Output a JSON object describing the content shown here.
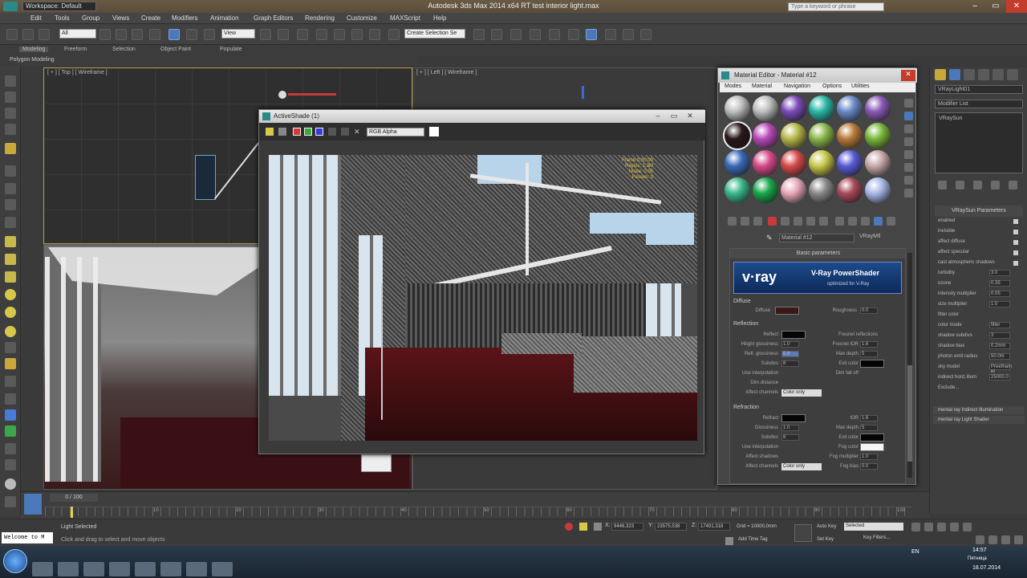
{
  "window": {
    "title": "Autodesk 3ds Max 2014 x64     RT test interior light.max",
    "workspace": "Workspace: Default",
    "search_placeholder": "Type a keyword or phrase"
  },
  "menu": [
    "Edit",
    "Tools",
    "Group",
    "Views",
    "Create",
    "Modifiers",
    "Animation",
    "Graph Editors",
    "Rendering",
    "Customize",
    "MAXScript",
    "Help"
  ],
  "toolbar": {
    "selection_filter": "All",
    "view": "View",
    "named_selection": "Create Selection Se"
  },
  "ribbon": {
    "tabs": [
      "Modeling",
      "Freeform",
      "Selection",
      "Object Paint",
      "Populate"
    ],
    "sub": "Polygon Modeling"
  },
  "viewports": {
    "top_label": "[ + ] [ Top ] [ Wireframe ]",
    "left_label": "[ + ] [ Left ] [ Wireframe ]"
  },
  "activeshade": {
    "title": "ActiveShade (1)",
    "channel": "RGB Alpha",
    "stats": [
      "Frame 0:00:00",
      "Rays/s: 1.3M",
      "Noise: 0.05",
      "Passes: 3"
    ]
  },
  "material_editor": {
    "title": "Material Editor - Material #12",
    "menu": [
      "Modes",
      "Material",
      "Navigation",
      "Options",
      "Utilities"
    ],
    "sphere_colors": [
      "#bfbfbf",
      "#bfbfbf",
      "#7b4bb8",
      "#2bb8a8",
      "#6a8ac8",
      "#8a5ab8",
      "#2a1818",
      "#b84ab8",
      "#b8b84a",
      "#8ab84a",
      "#b87a3a",
      "#7ab83a",
      "#3a6ab8",
      "#d84a8a",
      "#d84a4a",
      "#c8c84a",
      "#5a5ad8",
      "#c8a8a8",
      "#3ab88a",
      "#1aa84a",
      "#e8a8b8",
      "#8a8a8a",
      "#a84a5a",
      "#a8b8e8"
    ],
    "material_name": "Material #12",
    "material_type": "VRayMtl",
    "rollout": "Basic parameters",
    "vray_logo": "v·ray",
    "vray_title": "V-Ray PowerShader",
    "vray_sub": "optimized for V-Ray",
    "sections": {
      "diffuse": {
        "label": "Diffuse",
        "diffuse": "Diffuse",
        "roughness": "Roughness",
        "roughness_val": "0.0"
      },
      "reflection": {
        "label": "Reflection",
        "reflect": "Reflect",
        "hilight": "Hilight glossiness",
        "refl_gloss": "Refl. glossiness",
        "subdivs": "Subdivs",
        "use_interp": "Use interpolation",
        "dim_dist": "Dim distance",
        "affect_ch": "Affect channels",
        "fresnel": "Fresnel reflections",
        "fresnel_ior": "Fresnel IOR",
        "max_depth": "Max depth",
        "exit_color": "Exit color",
        "dim_falloff": "Dim fall off",
        "hilight_val": "1.0",
        "gloss_val": "0.8",
        "subdivs_val": "8",
        "fresnel_ior_val": "1.6",
        "maxdepth_val": "5",
        "color_only": "Color only"
      },
      "refraction": {
        "label": "Refraction",
        "refract": "Refract",
        "glossiness": "Glossiness",
        "subdivs": "Subdivs",
        "use_interp": "Use interpolation",
        "affect_shadows": "Affect shadows",
        "affect_ch": "Affect channels",
        "ior": "IOR",
        "max_depth": "Max depth",
        "exit_color": "Exit color",
        "fog_color": "Fog color",
        "fog_mult": "Fog multiplier",
        "fog_bias": "Fog bias",
        "ior_val": "1.6",
        "gloss_val": "1.0",
        "subdivs_val": "8",
        "maxdepth_val": "5",
        "fogmult_val": "1.0",
        "fogbias_val": "0.0",
        "color_only": "Color only"
      }
    }
  },
  "command_panel": {
    "object_name": "VRayLight01",
    "modifier_list": "Modifier List",
    "stack_item": "VRaySun",
    "params_title": "VRaySun Parameters",
    "params": [
      {
        "label": "enabled",
        "val": ""
      },
      {
        "label": "invisible",
        "val": ""
      },
      {
        "label": "affect diffuse",
        "val": ""
      },
      {
        "label": "affect specular",
        "val": ""
      },
      {
        "label": "cast atmospheric shadows",
        "val": ""
      },
      {
        "label": "turbidity",
        "val": "3.0"
      },
      {
        "label": "ozone",
        "val": "0.35"
      },
      {
        "label": "intensity multiplier",
        "val": "0.05"
      },
      {
        "label": "size multiplier",
        "val": "1.0"
      },
      {
        "label": "filter color",
        "val": ""
      },
      {
        "label": "color mode",
        "val": "filter"
      },
      {
        "label": "shadow subdivs",
        "val": "3"
      },
      {
        "label": "shadow bias",
        "val": "0.2mm"
      },
      {
        "label": "photon emit radius",
        "val": "50.0m"
      },
      {
        "label": "sky model",
        "val": "Preetham et"
      },
      {
        "label": "indirect horiz illum",
        "val": "25000.0"
      },
      {
        "label": "Exclude...",
        "val": ""
      }
    ],
    "mr_items": [
      "mental ray Indirect Illumination",
      "mental ray Light Shader"
    ]
  },
  "timeline": {
    "frame": "0 / 100",
    "ticks": [
      "0",
      "10",
      "20",
      "30",
      "40",
      "50",
      "60",
      "70",
      "80",
      "90",
      "100"
    ]
  },
  "status": {
    "welcome": "Welcome to M",
    "selected": "Light Selected",
    "prompt": "Click and drag to select and move objects",
    "x": "9446,323",
    "y": "23575,538",
    "z": "17491,318",
    "grid": "Grid = 10000,0mm",
    "add_time_tag": "Add Time Tag",
    "auto_key": "Auto Key",
    "set_key": "Set Key",
    "selected_dd": "Selected",
    "key_filters": "Key Filters..."
  },
  "taskbar": {
    "lang": "EN",
    "time": "14:57",
    "day": "Пятница",
    "date": "18.07.2014"
  }
}
